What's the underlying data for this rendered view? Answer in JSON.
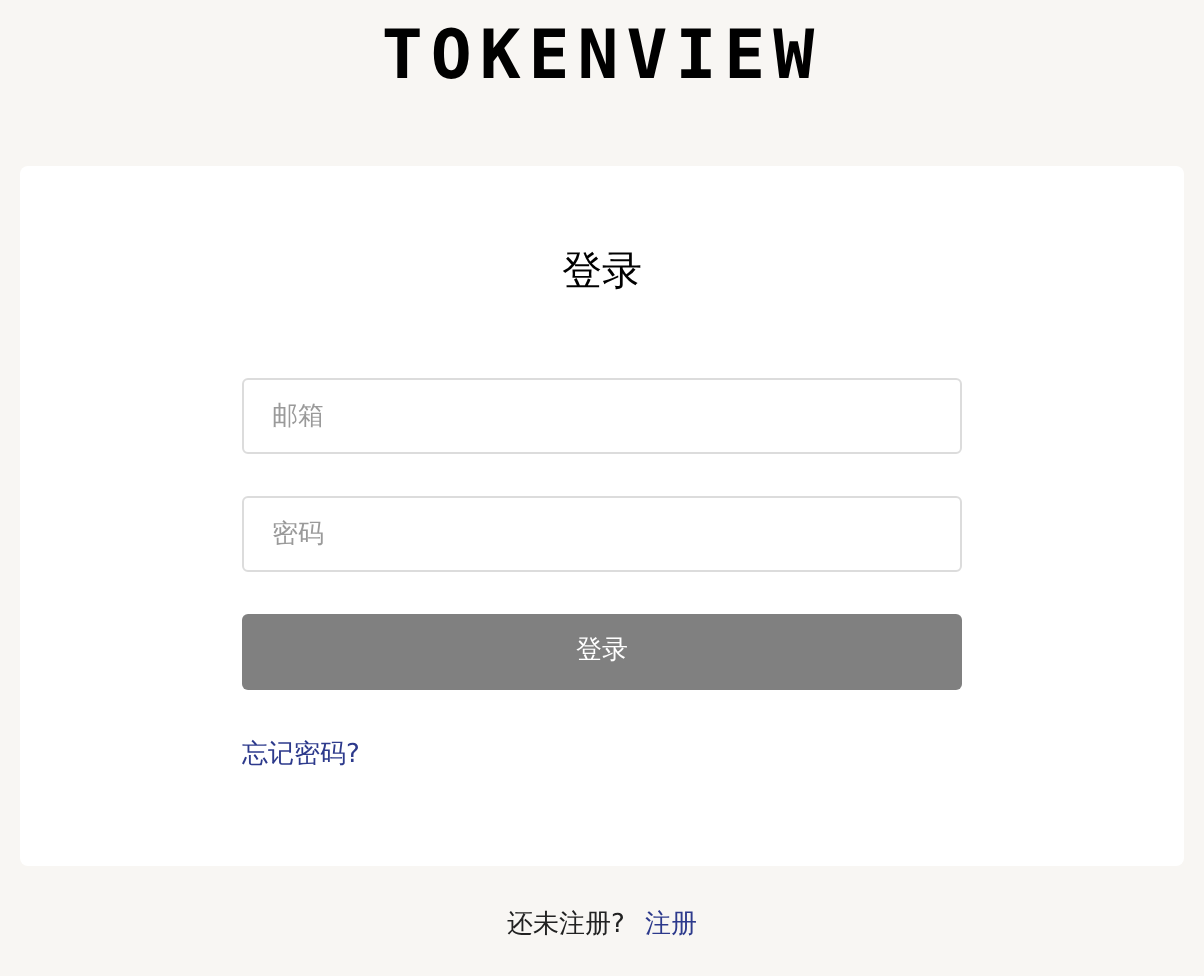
{
  "logo": "TOKENVIEW",
  "login_card": {
    "title": "登录",
    "fields": [
      {
        "placeholder": "邮箱"
      },
      {
        "placeholder": "密码"
      }
    ],
    "submit_button": "登录",
    "forgot_password_link": "忘记密码?"
  },
  "footer": {
    "prompt": "还未注册?",
    "register_link": "注册"
  }
}
